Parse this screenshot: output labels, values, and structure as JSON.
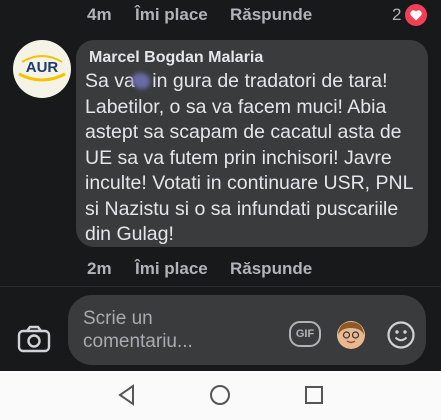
{
  "top_row": {
    "time": "4m",
    "like": "Îmi place",
    "reply": "Răspunde",
    "reaction_count": "2"
  },
  "comment": {
    "avatar_text": "AUR",
    "author": "Marcel Bogdan Malaria",
    "text_before": "Sa va",
    "text_after": "in gura de tradatori de tara! Labetilor, o sa va facem muci! Abia astept sa scapam de cacatul asta de UE sa va futem prin inchisori! Javre inculte! Votati in continuare USR, PNL si Nazistu si o sa infundati puscariile din Gulag!",
    "time": "2m",
    "like": "Îmi place",
    "reply": "Răspunde"
  },
  "composer": {
    "placeholder": "Scrie un comentariu...",
    "gif_label": "GIF"
  },
  "icons": [
    "heart-icon",
    "camera-icon",
    "gif-icon",
    "avatar-sticker-icon",
    "emoji-icon",
    "back-icon",
    "home-icon",
    "recents-icon"
  ],
  "colors": {
    "background": "#18191a",
    "bubble": "#3a3b3c",
    "reaction": "#f33e58",
    "logo": "#f6c200"
  }
}
